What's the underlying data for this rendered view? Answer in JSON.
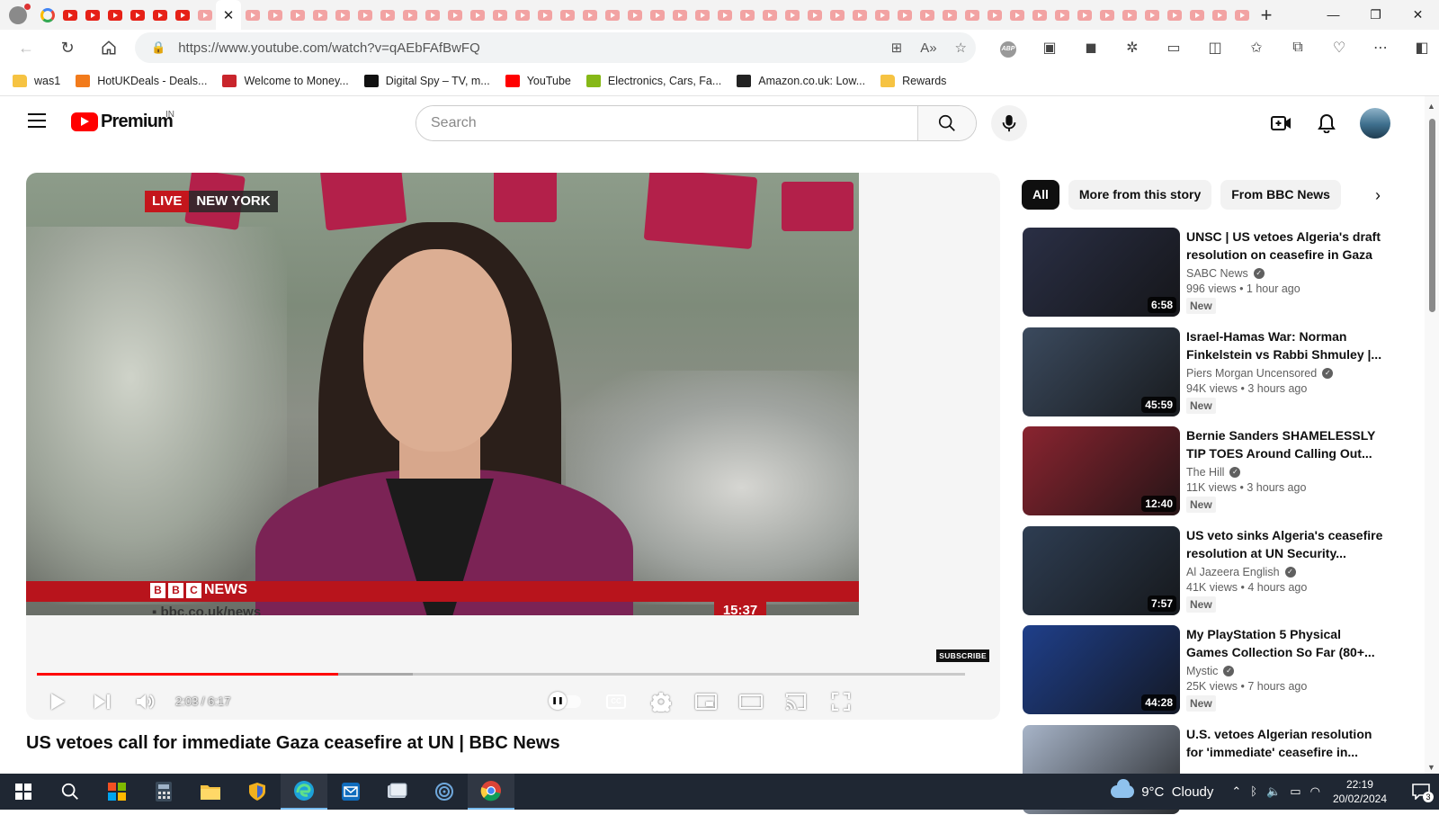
{
  "browser": {
    "url": "https://www.youtube.com/watch?v=qAEbFAfBwFQ",
    "bookmarks": [
      {
        "label": "was1",
        "icon": "folder-icon"
      },
      {
        "label": "HotUKDeals - Deals...",
        "icon": "hotukdeals-icon"
      },
      {
        "label": "Welcome to Money...",
        "icon": "mse-icon"
      },
      {
        "label": "Digital Spy – TV, m...",
        "icon": "digitalspy-icon"
      },
      {
        "label": "YouTube",
        "icon": "youtube-icon"
      },
      {
        "label": "Electronics, Cars, Fa...",
        "icon": "ebay-icon"
      },
      {
        "label": "Amazon.co.uk: Low...",
        "icon": "amazon-icon"
      },
      {
        "label": "Rewards",
        "icon": "folder-icon"
      }
    ]
  },
  "youtube": {
    "logo_text": "Premium",
    "country_code": "IN",
    "search_placeholder": "Search"
  },
  "player": {
    "live_label": "LIVE",
    "location_label": "NEW YORK",
    "news_brand": "NEWS",
    "news_url": "bbc.co.uk/news",
    "news_clock": "15:37",
    "subscribe_watermark": "SUBSCRIBE",
    "time_display": "2:03 / 6:17",
    "played_fraction": 0.325,
    "buffered_fraction": 0.405,
    "cc_label": "CC"
  },
  "video": {
    "title": "US vetoes call for immediate Gaza ceasefire at UN | BBC News"
  },
  "chips": [
    "All",
    "More from this story",
    "From BBC News"
  ],
  "recommendations": [
    {
      "title": "UNSC | US vetoes Algeria's draft resolution on ceasefire in Gaza",
      "channel": "SABC News",
      "views": "996 views",
      "age": "1 hour ago",
      "duration": "6:58",
      "badge": "New",
      "thumb_color": "#2a2f45"
    },
    {
      "title": "Israel-Hamas War: Norman Finkelstein vs Rabbi Shmuley |...",
      "channel": "Piers Morgan Uncensored",
      "views": "94K views",
      "age": "3 hours ago",
      "duration": "45:59",
      "badge": "New",
      "thumb_color": "#3b4a5e"
    },
    {
      "title": "Bernie Sanders SHAMELESSLY TIP TOES Around Calling Out...",
      "channel": "The Hill",
      "views": "11K views",
      "age": "3 hours ago",
      "duration": "12:40",
      "badge": "New",
      "thumb_color": "#8a2430"
    },
    {
      "title": "US veto sinks Algeria's ceasefire resolution at UN Security...",
      "channel": "Al Jazeera English",
      "views": "41K views",
      "age": "4 hours ago",
      "duration": "7:57",
      "badge": "New",
      "thumb_color": "#2e3d52"
    },
    {
      "title": "My PlayStation 5 Physical Games Collection So Far (80+...",
      "channel": "Mystic",
      "views": "25K views",
      "age": "7 hours ago",
      "duration": "44:28",
      "badge": "New",
      "thumb_color": "#1f3f8a"
    },
    {
      "title": "U.S. vetoes Algerian resolution for 'immediate' ceasefire in...",
      "channel": "",
      "views": "",
      "age": "",
      "duration": "",
      "badge": "",
      "thumb_color": "#a7b4c8"
    }
  ],
  "taskbar": {
    "weather": "9°C  Cloudy",
    "time": "22:19",
    "date": "20/02/2024",
    "notification_count": "3"
  }
}
